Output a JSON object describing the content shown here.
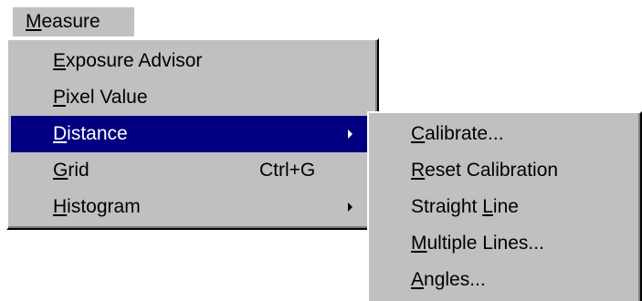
{
  "menubar": {
    "label_accel": "M",
    "label_rest": "easure"
  },
  "measure_menu": {
    "items": [
      {
        "accel": "E",
        "rest": "xposure Advisor",
        "shortcut": "",
        "has_submenu": false,
        "selected": false
      },
      {
        "accel": "P",
        "rest": "ixel Value",
        "shortcut": "",
        "has_submenu": false,
        "selected": false
      },
      {
        "accel": "D",
        "rest": "istance",
        "shortcut": "",
        "has_submenu": true,
        "selected": true
      },
      {
        "accel": "G",
        "rest": "rid",
        "shortcut": "Ctrl+G",
        "has_submenu": false,
        "selected": false
      },
      {
        "accel": "H",
        "rest": "istogram",
        "shortcut": "",
        "has_submenu": true,
        "selected": false
      }
    ]
  },
  "distance_submenu": {
    "items": [
      {
        "pre": "",
        "accel": "C",
        "rest": "alibrate..."
      },
      {
        "pre": "",
        "accel": "R",
        "rest": "eset Calibration"
      },
      {
        "pre": "Straight ",
        "accel": "L",
        "rest": "ine"
      },
      {
        "pre": "",
        "accel": "M",
        "rest": "ultiple Lines..."
      },
      {
        "pre": "",
        "accel": "A",
        "rest": "ngles..."
      }
    ]
  },
  "colors": {
    "menu_face": "#c0c0c0",
    "highlight": "#000080",
    "highlight_text": "#ffffff"
  }
}
